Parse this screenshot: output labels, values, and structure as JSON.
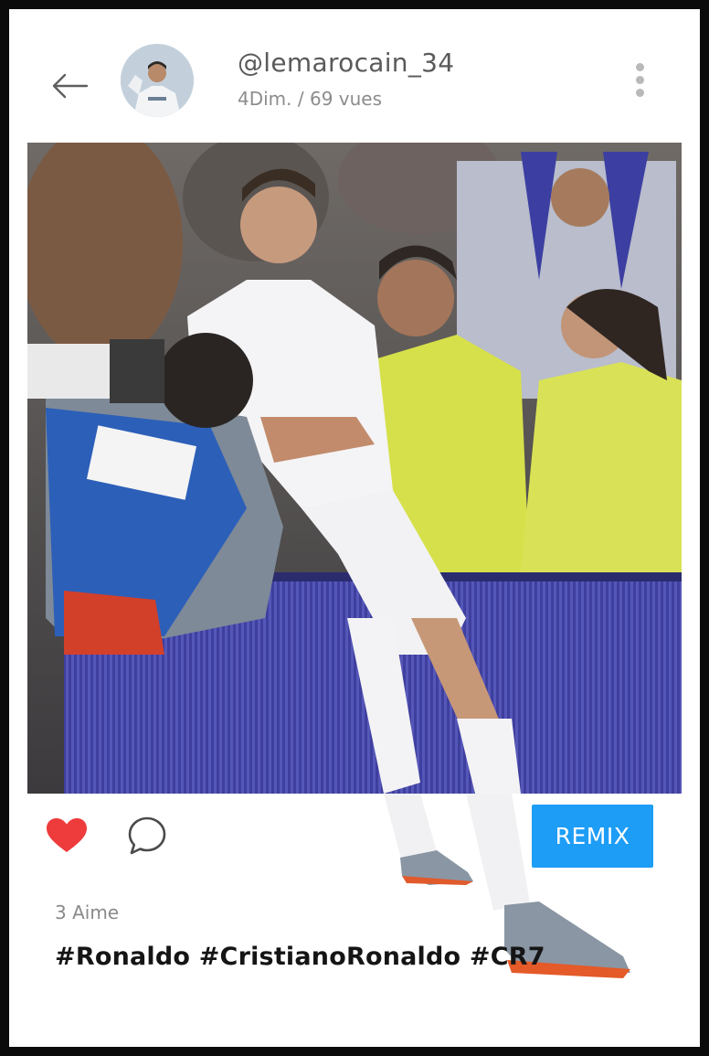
{
  "header": {
    "username": "@lemarocain_34",
    "meta": "4Dim. / 69 vues",
    "back_icon": "arrow-left-icon",
    "more_icon": "more-vertical-icon"
  },
  "post": {
    "likes_text": "3 Aime",
    "caption": "#Ronaldo #CristianoRonaldo #CR7",
    "remix_label": "REMIX",
    "like_icon": "heart-icon",
    "comment_icon": "comment-icon",
    "liked": true
  },
  "colors": {
    "heart": "#ee3b3b",
    "remix_button": "#1e9df6",
    "frame": "#0b0b0b",
    "background": "#ffffff"
  }
}
